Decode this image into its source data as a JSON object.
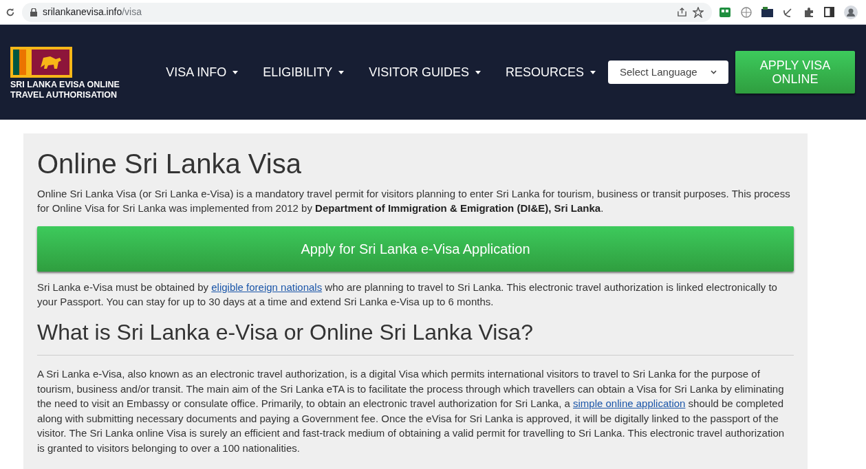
{
  "browser": {
    "domain": "srilankanevisa.info",
    "path": "/visa"
  },
  "header": {
    "logo_lines": [
      "SRI LANKA EVISA ONLINE",
      "TRAVEL AUTHORISATION"
    ],
    "nav": [
      {
        "label": "VISA INFO"
      },
      {
        "label": "ELIGIBILITY"
      },
      {
        "label": "VISITOR GUIDES"
      },
      {
        "label": "RESOURCES"
      }
    ],
    "language_select": "Select Language",
    "apply_button": "APPLY VISA ONLINE"
  },
  "main": {
    "title": "Online Sri Lanka Visa",
    "intro": [
      {
        "kind": "text",
        "text": "Online Sri Lanka Visa (or Sri Lanka e-Visa) is a mandatory travel permit for visitors planning to enter Sri Lanka for tourism, business or transit purposes. This process for Online Visa for Sri Lanka was implemented from 2012 by **Department of Immigration & Emigration (DI&E), Sri Lanka**."
      }
    ],
    "cta": "Apply for Sri Lanka e-Visa Application",
    "paragraph_2": [
      {
        "kind": "text",
        "text": "Sri Lanka e-Visa must be obtained by "
      },
      {
        "kind": "link",
        "text": "eligible foreign nationals"
      },
      {
        "kind": "text",
        "text": " who are planning to travel to Sri Lanka. This electronic travel authorization is linked electronically to your Passport. You can stay for up to 30 days at a time and extend Sri Lanka e-Visa up to 6 months."
      }
    ],
    "heading": "What is Sri Lanka e-Visa or Online Sri Lanka Visa?",
    "paragraph_3": [
      {
        "kind": "text",
        "text": "A Sri Lanka e-Visa, also known as an electronic travel authorization, is a digital Visa which permits international visitors to travel to Sri Lanka for the purpose of tourism, business and/or transit. The main aim of the Sri Lanka eTA is to facilitate the process through which travellers can obtain a Visa for Sri Lanka by eliminating the need to visit an Embassy or consulate office. Primarily, to obtain an electronic travel authorization for Sri Lanka, a "
      },
      {
        "kind": "link",
        "text": "simple online application"
      },
      {
        "kind": "text",
        "text": " should be completed along with submitting necessary documents and paying a Government fee. Once the eVisa for Sri Lanka is approved, it will be digitally linked to the passport of the visitor. The Sri Lanka online Visa is surely an efficient and fast-track medium of obtaining a valid permit for travelling to Sri Lanka. This electronic travel authorization is granted to visitors belonging to over a 100 nationalities."
      }
    ]
  }
}
